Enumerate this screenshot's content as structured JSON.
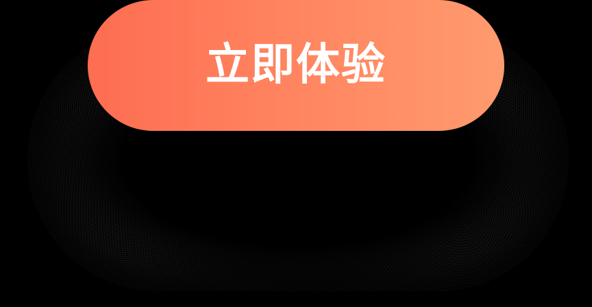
{
  "cta": {
    "label": "立即体验"
  },
  "colors": {
    "background": "#000000",
    "button_gradient_start": "#FE6D51",
    "button_gradient_end": "#FF9B6E",
    "label": "#FFFFFF"
  }
}
